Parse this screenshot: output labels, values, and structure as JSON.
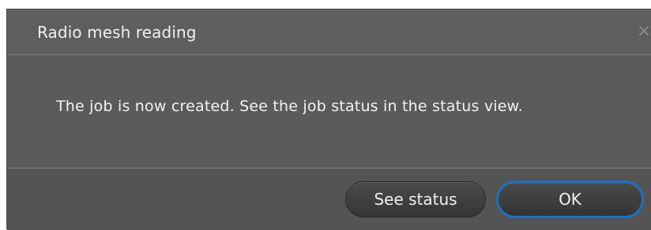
{
  "dialog": {
    "title": "Radio mesh reading",
    "close_icon": "×",
    "message": "The job is now created. See the job status in the status view.",
    "buttons": {
      "see_status": "See status",
      "ok": "OK"
    },
    "accent_color": "#1f6fc4"
  }
}
